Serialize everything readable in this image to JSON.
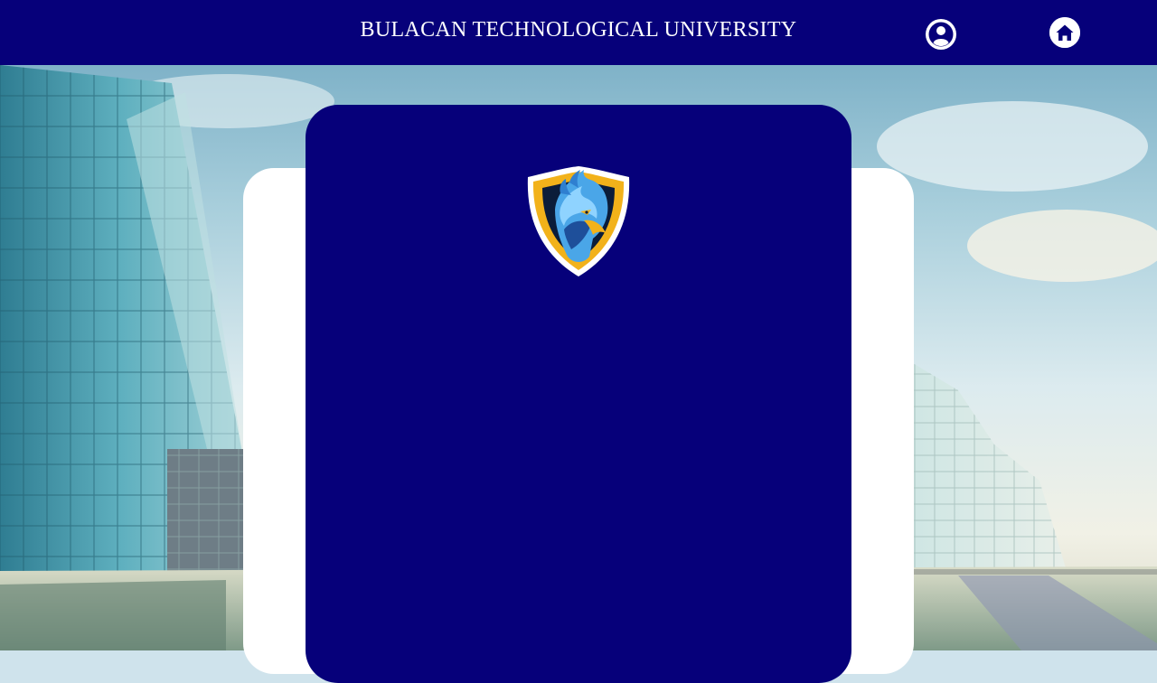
{
  "header": {
    "title": "BULACAN TECHNOLOGICAL UNIVERSITY",
    "profile_icon": "user-circle-icon",
    "home_icon": "home-icon"
  },
  "logo": {
    "icon": "eagle-shield-logo"
  },
  "colors": {
    "header_bg": "#06007a",
    "card_bg": "#06007a",
    "panel_bg": "#ffffff",
    "logo_gold": "#f2b21a",
    "logo_blue": "#4aa6e8"
  }
}
